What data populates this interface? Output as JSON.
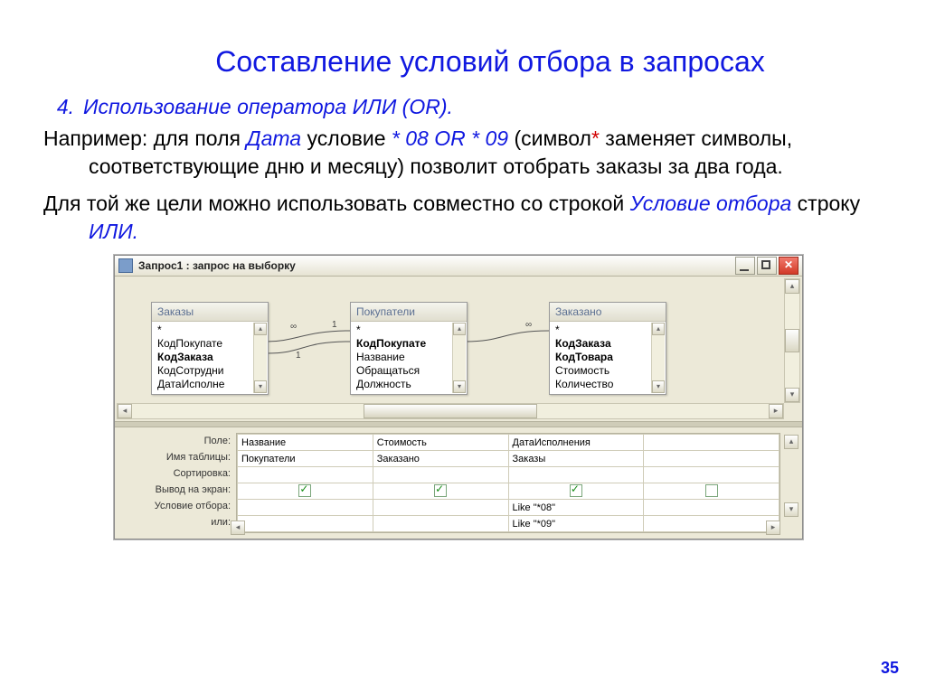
{
  "title": "Составление условий отбора в запросах",
  "list_num": "4.",
  "list_text": "Использование оператора ИЛИ (OR).",
  "para1": {
    "lead": "Например: ",
    "t1": "для поля ",
    "date": "Дата",
    "t2": " условие ",
    "cond": "* 08 OR * 09",
    "t3": " (символ",
    "star": "*",
    "t4": " заменяет символы, соответствующие дню и месяцу) позволит отобрать заказы за два года."
  },
  "para2": {
    "t1": "Для той же цели можно использовать совместно со строкой ",
    "crit": "Условие отбора",
    "t2": " строку ",
    "or": "ИЛИ."
  },
  "page": "35",
  "window": {
    "title": "Запрос1 : запрос на выборку",
    "tables": [
      {
        "name": "Заказы",
        "fields": [
          "*",
          "КодПокупате",
          "КодЗаказа",
          "КодСотрудни",
          "ДатаИсполне"
        ],
        "bold": [
          2
        ]
      },
      {
        "name": "Покупатели",
        "fields": [
          "*",
          "КодПокупате",
          "Название",
          "Обращаться",
          "Должность"
        ],
        "bold": [
          1
        ]
      },
      {
        "name": "Заказано",
        "fields": [
          "*",
          "КодЗаказа",
          "КодТовара",
          "Стоимость",
          "Количество"
        ],
        "bold": [
          1,
          2
        ]
      }
    ],
    "join_labels": {
      "inf": "∞",
      "one": "1"
    },
    "grid": {
      "rows": [
        "Поле:",
        "Имя таблицы:",
        "Сортировка:",
        "Вывод на экран:",
        "Условие отбора:",
        "или:"
      ],
      "cols": [
        {
          "field": "Название",
          "table": "Покупатели",
          "sort": "",
          "show": true,
          "crit": "",
          "or": ""
        },
        {
          "field": "Стоимость",
          "table": "Заказано",
          "sort": "",
          "show": true,
          "crit": "",
          "or": ""
        },
        {
          "field": "ДатаИсполнения",
          "table": "Заказы",
          "sort": "",
          "show": true,
          "crit": "Like \"*08\"",
          "or": "Like \"*09\""
        },
        {
          "field": "",
          "table": "",
          "sort": "",
          "show": false,
          "crit": "",
          "or": ""
        }
      ]
    }
  }
}
